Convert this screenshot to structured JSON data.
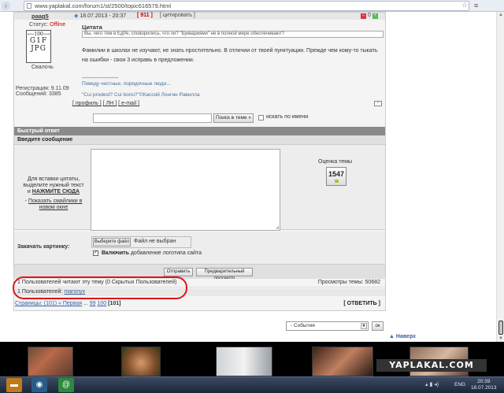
{
  "browser": {
    "url": "www.yaplakal.com/forum1/st/2500/topic616579.html"
  },
  "post": {
    "author": "paag5",
    "date": "18.07.2013 - 20:37",
    "post_number": "[ 911 ]",
    "quote_link": "[ цитировать ]",
    "rating_minus": "0",
    "rating_plus": "+",
    "status_label": "Статус:",
    "status_value": "Offline",
    "avatar_lines": [
      "⟵100⟶",
      "G1F",
      "JPG"
    ],
    "avatar_caption": "Свалочь",
    "registered": "Регистрация: 9.11.09",
    "messages": "Сообщений: 3385",
    "quote_title": "Цитата",
    "quote_text": "Вы, чего тем в ЕдРе, споворились, что ли? \"Буквариями\" не в полной мере обеспечивают?",
    "body": "Фамилии в школах не изучают, не знать простительно. В отличии от твоей пунктуации. Прежде чем кому-то тыкать на ошибки - свои 3 исправь в предложении.",
    "signature_dash": "--------------------",
    "signature_line1": "Поведу честные, порядочные люди...",
    "signature_line2": "\"Cui prodest? Cui bono?\"©Кассий Лонгин Равилла",
    "profile_links": [
      "[ профиль ]",
      "[ ЛН ]",
      "[ e-mail ]"
    ],
    "up_button": "⌃"
  },
  "search": {
    "button": "Поиск в теме »",
    "checkbox_label": "искать по имени"
  },
  "quick_reply": {
    "header": "Быстрый ответ",
    "message_header": "Введите сообщение",
    "hint_line1": "Для вставки цитаты, выделите нужный текст и",
    "hint_bold": "НАЖМИТЕ СЮДА",
    "smiles_prefix": "- ",
    "smiles_link": "Показать смайлики в новом окне",
    "rating_label": "Оценка темы",
    "rating_value": "1547",
    "upload_label": "Закачать картинку:",
    "file_button": "Выберите файл",
    "file_status": "Файл не выбран",
    "logo_checkbox_bold": "Включить",
    "logo_checkbox_rest": " добавление логотипа сайта",
    "send_button": "Отправить",
    "preview_button": "Предварительный просмотр"
  },
  "readers": {
    "reading": "1 Пользователей читают эту тему (0 Скрытых Пользователей)",
    "views": "Просмотры темы: 50682",
    "users_prefix": "1 Пользователей: ",
    "user": "maronyx"
  },
  "pager": {
    "label": "Страницы: (101) ",
    "first": "« Первая",
    "dots": " ... ",
    "p99": "99",
    "p100": "100",
    "current": "[101]",
    "reply": "[ ОТВЕТИТЬ ]"
  },
  "footer": {
    "events_select": "- События",
    "ok_button": "ок",
    "top_link": "Наверх"
  },
  "watermark": "YAPLAKAL.COM",
  "taskbar": {
    "lang": "ENG",
    "time": "20:39",
    "date": "18.07.2013"
  },
  "colors": {
    "highlight_oval": "#e1141c",
    "link": "#3a5fa0",
    "offline_status": "#cc0000"
  }
}
